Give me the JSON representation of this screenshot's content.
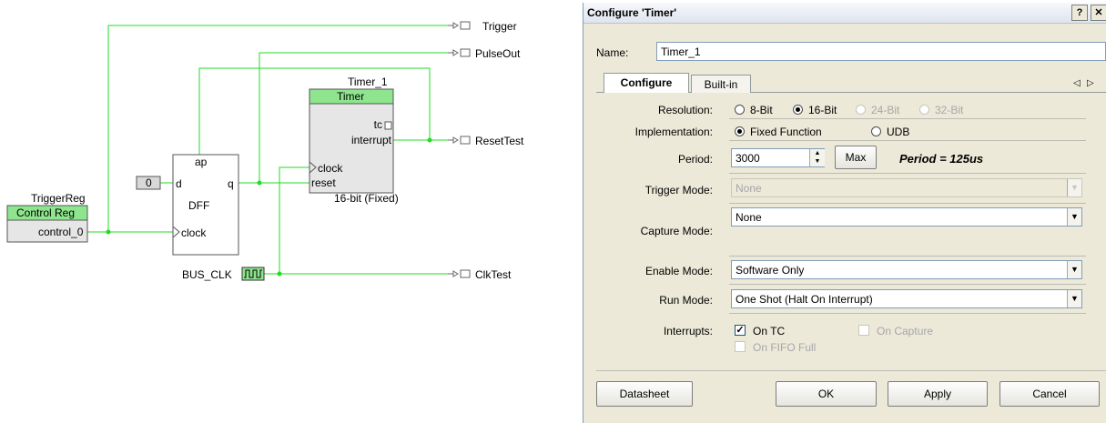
{
  "schematic": {
    "pins": {
      "trigger": "Trigger",
      "pulseout": "PulseOut",
      "resettest": "ResetTest",
      "clktest": "ClkTest"
    },
    "timer": {
      "instance": "Timer_1",
      "type": "Timer",
      "tc": "tc",
      "interrupt": "interrupt",
      "clock": "clock",
      "reset": "reset",
      "footer": "16-bit (Fixed)"
    },
    "dff": {
      "ap": "ap",
      "d": "d",
      "q": "q",
      "name": "DFF",
      "clock": "clock"
    },
    "const": "0",
    "controlreg": {
      "instance": "TriggerReg",
      "type": "Control Reg",
      "port": "control_0"
    },
    "busclk": "BUS_CLK"
  },
  "dialog": {
    "title": "Configure 'Timer'",
    "help_btn": "?",
    "close_btn": "✕",
    "name_label": "Name:",
    "name_value": "Timer_1",
    "tabs": [
      "Configure",
      "Built-in"
    ],
    "resolution": {
      "label": "Resolution:",
      "options": [
        "8-Bit",
        "16-Bit",
        "24-Bit",
        "32-Bit"
      ],
      "selected": "16-Bit"
    },
    "implementation": {
      "label": "Implementation:",
      "options": [
        "Fixed Function",
        "UDB"
      ],
      "selected": "Fixed Function"
    },
    "period": {
      "label": "Period:",
      "value": "3000",
      "max_label": "Max",
      "info": "Period = 125us"
    },
    "trigger_mode": {
      "label": "Trigger Mode:",
      "value": "None"
    },
    "capture_mode": {
      "label": "Capture Mode:",
      "value": "None"
    },
    "enable_mode": {
      "label": "Enable Mode:",
      "value": "Software Only"
    },
    "run_mode": {
      "label": "Run Mode:",
      "value": "One Shot (Halt On Interrupt)"
    },
    "interrupts": {
      "label": "Interrupts:",
      "on_tc": "On TC",
      "on_capture": "On Capture",
      "on_fifo_full": "On FIFO Full"
    },
    "buttons": {
      "datasheet": "Datasheet",
      "ok": "OK",
      "apply": "Apply",
      "cancel": "Cancel"
    },
    "colors": {
      "wire": "#00ee00",
      "block_header": "#8ee58e",
      "block_body": "#e6e6e6"
    }
  }
}
